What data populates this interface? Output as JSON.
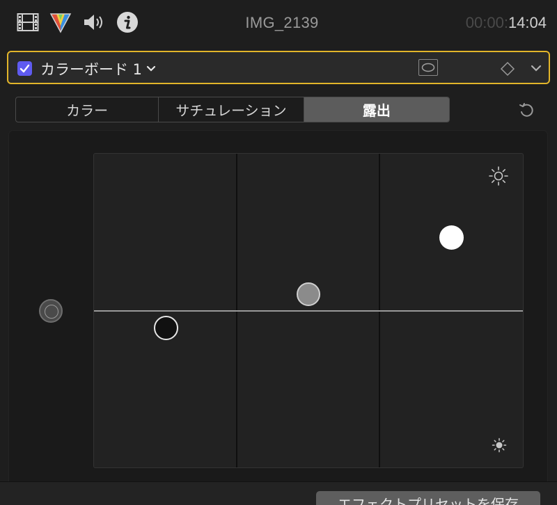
{
  "header": {
    "title": "IMG_2139",
    "timecode_dim": "00:00:",
    "timecode_bright": "14:04",
    "icons": [
      "film-icon",
      "color-prism-icon",
      "speaker-icon",
      "info-icon"
    ]
  },
  "effect": {
    "name": "カラーボード 1",
    "enabled": true,
    "icons": [
      "mask-icon",
      "keyframe-diamond-icon",
      "chevron-down-icon"
    ]
  },
  "tabs": [
    {
      "label": "カラー",
      "active": false
    },
    {
      "label": "サチュレーション",
      "active": false
    },
    {
      "label": "露出",
      "active": true
    }
  ],
  "board": {
    "pucks": [
      {
        "name": "global",
        "icon": "global-puck-icon"
      },
      {
        "name": "highlights",
        "color": "#ffffff"
      },
      {
        "name": "midtones",
        "color": "#8b8b8b"
      },
      {
        "name": "shadows",
        "color": "#111111"
      }
    ],
    "icons": [
      "sun-large-icon",
      "sun-small-icon",
      "reset-arrow-icon"
    ]
  },
  "footer": {
    "save_preset_label": "エフェクトプリセットを保存"
  },
  "colors": {
    "accent_border": "#e2b52a",
    "checkbox": "#5f5bf0",
    "active_tab": "#5c5c5c"
  }
}
